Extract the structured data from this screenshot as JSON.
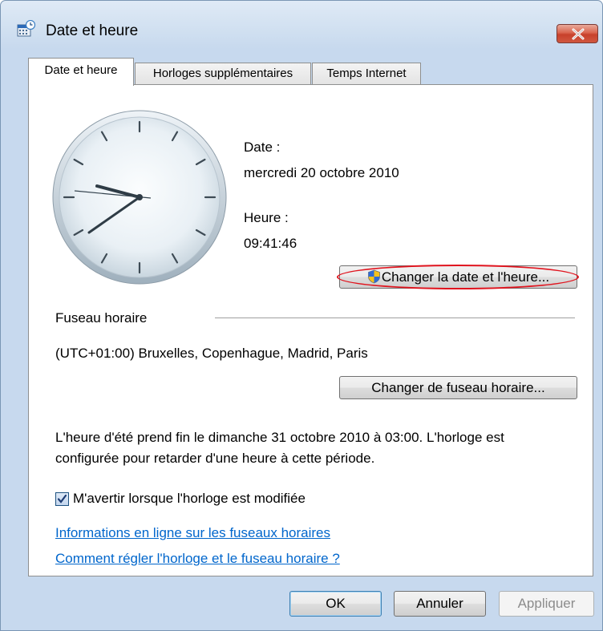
{
  "window": {
    "title": "Date et heure"
  },
  "tabs": [
    {
      "label": "Date et heure"
    },
    {
      "label": "Horloges supplémentaires"
    },
    {
      "label": "Temps Internet"
    }
  ],
  "datetime": {
    "date_label": "Date :",
    "date_value": "mercredi 20 octobre 2010",
    "time_label": "Heure :",
    "time_value": "09:41:46",
    "change_datetime_button": "Changer la date et l'heure..."
  },
  "timezone": {
    "section_label": "Fuseau horaire",
    "value": "(UTC+01:00) Bruxelles, Copenhague, Madrid, Paris",
    "change_timezone_button": "Changer de fuseau horaire..."
  },
  "dst_notice": {
    "line1": "L'heure d'été prend fin le dimanche 31 octobre 2010 à 03:00. L'horloge est",
    "line2": "configurée pour retarder d'une heure à cette période."
  },
  "notify": {
    "label": "M'avertir lorsque l'horloge est modifiée",
    "checked": true
  },
  "links": {
    "timezone_info": "Informations en ligne sur les fuseaux horaires",
    "how_to_set": "Comment régler l'horloge et le fuseau horaire ?"
  },
  "footer": {
    "ok": "OK",
    "cancel": "Annuler",
    "apply": "Appliquer"
  },
  "icons": {
    "app": "calendar-clock-icon",
    "close": "close-icon",
    "uac_shield": "uac-shield-icon",
    "checkmark": "checkmark-icon"
  },
  "colors": {
    "close_button": "#c8412b",
    "link": "#0066cc",
    "highlight_ellipse": "#e0141e"
  }
}
